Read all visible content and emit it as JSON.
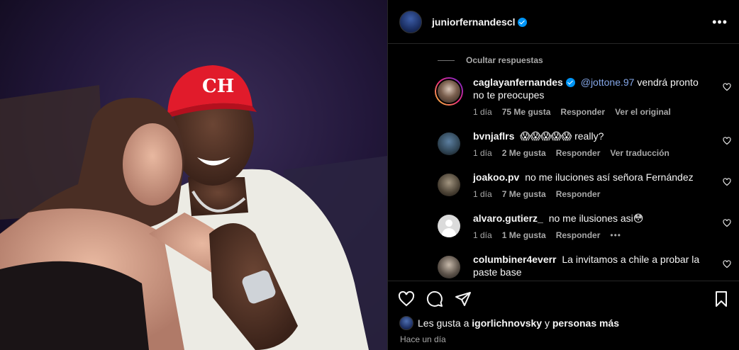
{
  "header": {
    "username": "juniorfernandescl",
    "more_icon": "more-options-icon"
  },
  "thread": {
    "hide_replies_label": "Ocultar respuestas"
  },
  "comments": [
    {
      "username": "caglayanfernandes",
      "verified": true,
      "mention": "@jottone.97",
      "text": "vendrá pronto no te preocupes",
      "time": "1 día",
      "likes": "75 Me gusta",
      "reply": "Responder",
      "extra": "Ver el original"
    },
    {
      "username": "bvnjaflrs",
      "text": "😱😱😱😱😱 really?",
      "time": "1 día",
      "likes": "2 Me gusta",
      "reply": "Responder",
      "extra": "Ver traducción"
    },
    {
      "username": "joakoo.pv",
      "text": "no me iluciones así señora Fernández",
      "time": "1 día",
      "likes": "7 Me gusta",
      "reply": "Responder"
    },
    {
      "username": "alvaro.gutierz_",
      "text": "no me ilusiones asi😳",
      "time": "1 día",
      "likes": "1 Me gusta",
      "reply": "Responder",
      "extra": "•••"
    },
    {
      "username": "columbiner4everr",
      "text": "La invitamos a chile a probar la paste base"
    }
  ],
  "post": {
    "liked_by_prefix": "Les gusta a",
    "liked_by_user": "igorlichnovsky",
    "liked_by_joiner": "y",
    "liked_by_suffix": "personas más",
    "timestamp": "Hace un día"
  },
  "colors": {
    "background": "#000000",
    "text": "#f5f5f5",
    "muted": "#a8a8a8",
    "verified": "#0095f6",
    "mention": "#85a7e8"
  }
}
